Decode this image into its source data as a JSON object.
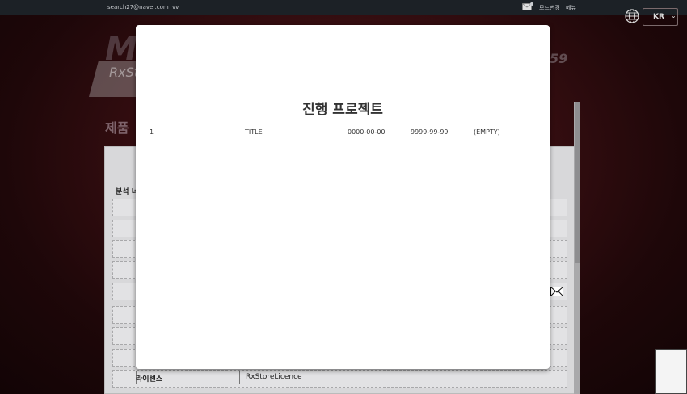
{
  "topbar": {
    "email": "search27@naver.com",
    "user": "vv",
    "mode_change": "모드변경",
    "menu": "메뉴"
  },
  "language": {
    "code": "KR"
  },
  "background": {
    "page_title": "제품",
    "analysis_label": "분석 너",
    "license_label": "라이센스",
    "license_value": "RxStoreLicence",
    "logo_number": "59"
  },
  "modal": {
    "title": "진행 프로젝트",
    "projects": [
      {
        "no": "1",
        "title": "TITLE",
        "start": "0000-00-00",
        "end": "9999-99-99",
        "status": "(EMPTY)"
      }
    ]
  }
}
